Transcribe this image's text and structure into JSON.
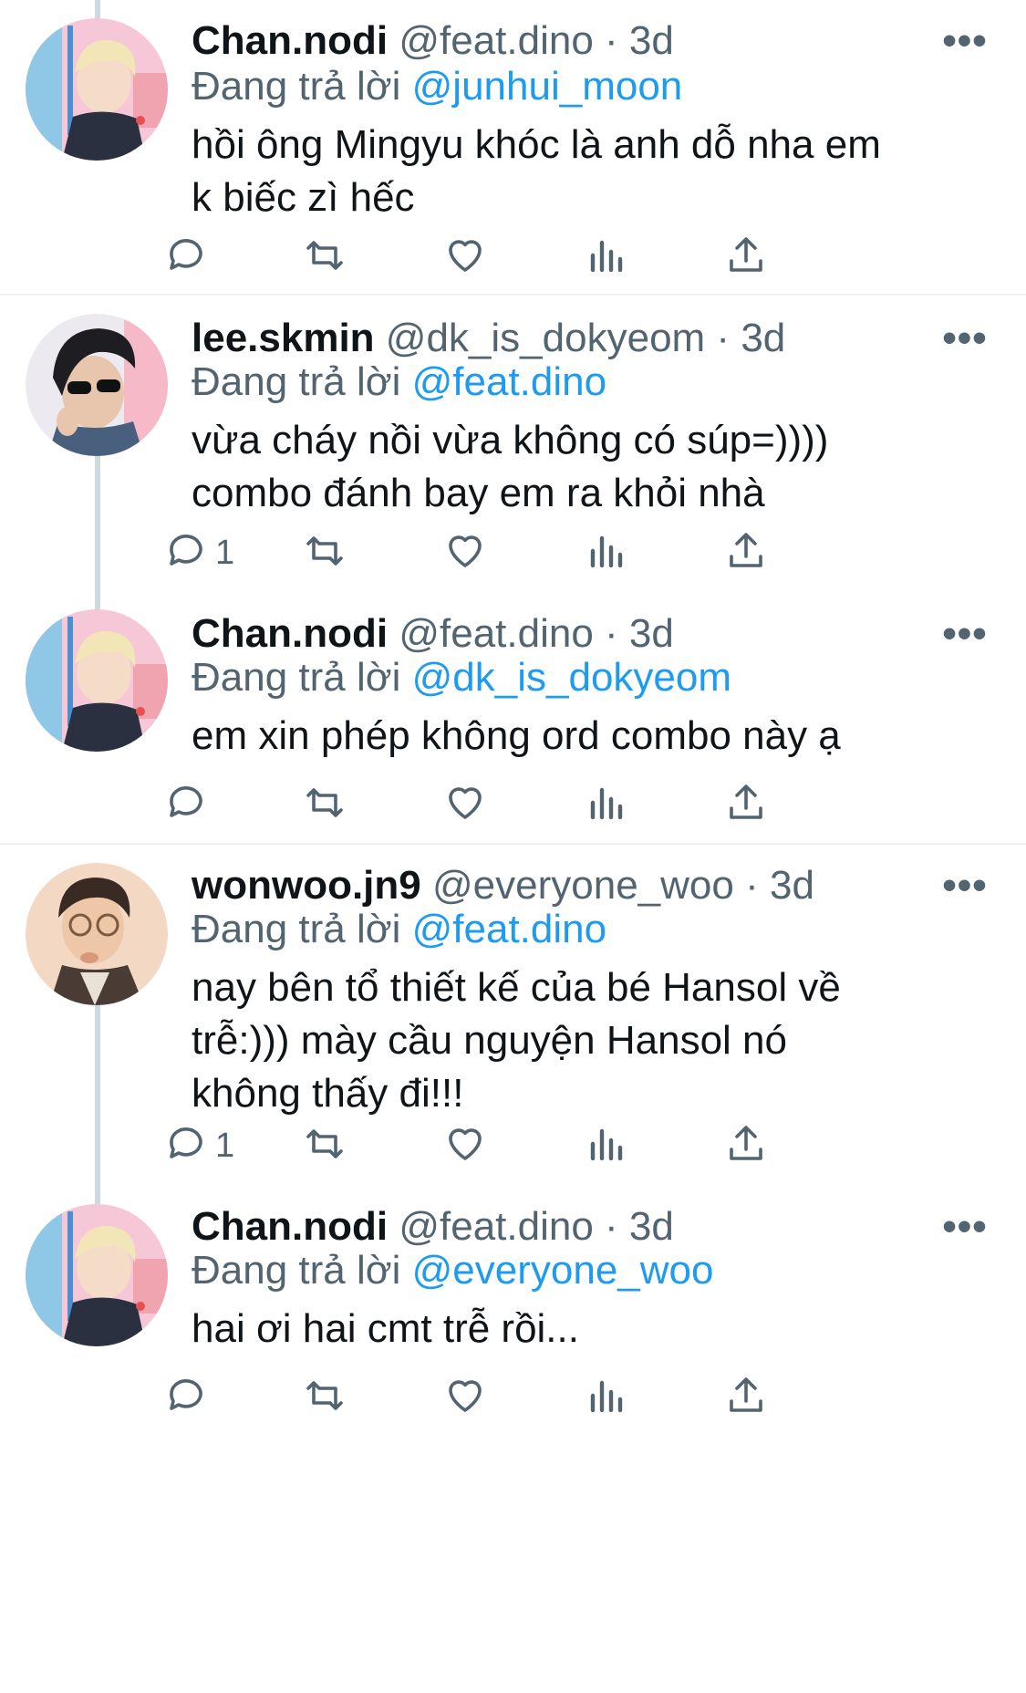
{
  "reply_prefix": "Đang trả lời",
  "more_glyph": "•••",
  "accent_color": "#1d9bf0",
  "tweets": [
    {
      "name": "Chan.nodi",
      "handle": "@feat.dino",
      "dot": "·",
      "time": "3d",
      "reply_to": "@junhui_moon",
      "text": "hồi ông Mingyu khóc là anh dỗ nha em\nk biếc zì hếc",
      "reply_count": "",
      "avatar": "blonde-boy-pink-avatar"
    },
    {
      "name": "lee.skmin",
      "handle": "@dk_is_dokyeom",
      "dot": "·",
      "time": "3d",
      "reply_to": "@feat.dino",
      "text": "vừa cháy nồi vừa không có súp=))))\ncombo đánh bay em ra khỏi nhà",
      "reply_count": "1",
      "avatar": "sunglasses-boy-avatar"
    },
    {
      "name": "Chan.nodi",
      "handle": "@feat.dino",
      "dot": "·",
      "time": "3d",
      "reply_to": "@dk_is_dokyeom",
      "text": "em xin phép không ord combo này ạ",
      "reply_count": "",
      "avatar": "blonde-boy-pink-avatar"
    },
    {
      "name": "wonwoo.jn9",
      "handle": "@everyone_woo",
      "dot": "·",
      "time": "3d",
      "reply_to": "@feat.dino",
      "text": "nay bên tổ thiết kế của bé Hansol về\ntrễ:))) mày cầu nguyện Hansol nó\nkhông thấy đi!!!",
      "reply_count": "1",
      "avatar": "glasses-boy-avatar"
    },
    {
      "name": "Chan.nodi",
      "handle": "@feat.dino",
      "dot": "·",
      "time": "3d",
      "reply_to": "@everyone_woo",
      "text": "hai ơi hai cmt trễ rồi...",
      "reply_count": "",
      "avatar": "blonde-boy-pink-avatar"
    }
  ]
}
